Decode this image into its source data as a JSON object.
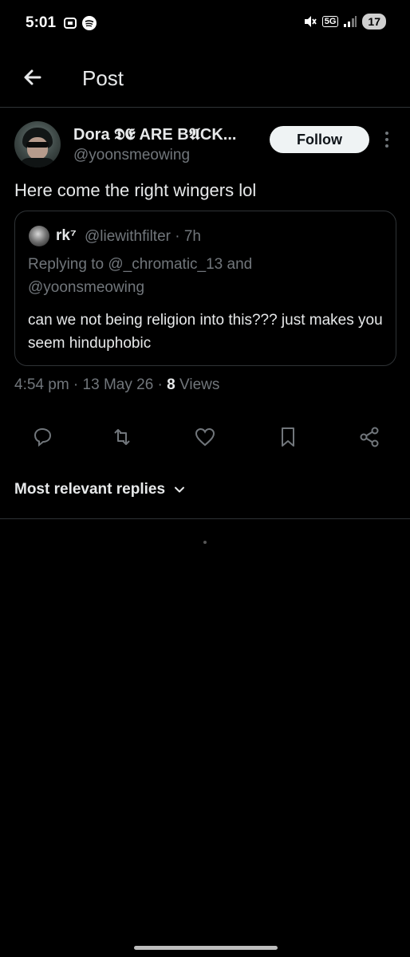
{
  "status_bar": {
    "time": "5:01",
    "network": "5G",
    "battery": "17"
  },
  "header": {
    "title": "Post"
  },
  "post": {
    "display_name": "Dora 𝕯𝕰 ARE B𝕬CK...",
    "handle": "@yoonsmeowing",
    "follow_label": "Follow",
    "text": "Here come the right wingers lol",
    "timestamp": "4:54 pm · 13 May 26 · ",
    "views_count": "8",
    "views_label": " Views"
  },
  "quoted": {
    "name": "rk⁷",
    "handle_time": "@liewithfilter · 7h",
    "replying_line1": "Replying to @_chromatic_13 and",
    "replying_line2": "@yoonsmeowing",
    "text": "can we not being religion into this??? just makes you seem hinduphobic"
  },
  "replies": {
    "sort_label": "Most relevant replies"
  },
  "colors": {
    "background": "#000000",
    "text": "#e7e9ea",
    "muted": "#71767b",
    "divider": "#2f3336"
  }
}
